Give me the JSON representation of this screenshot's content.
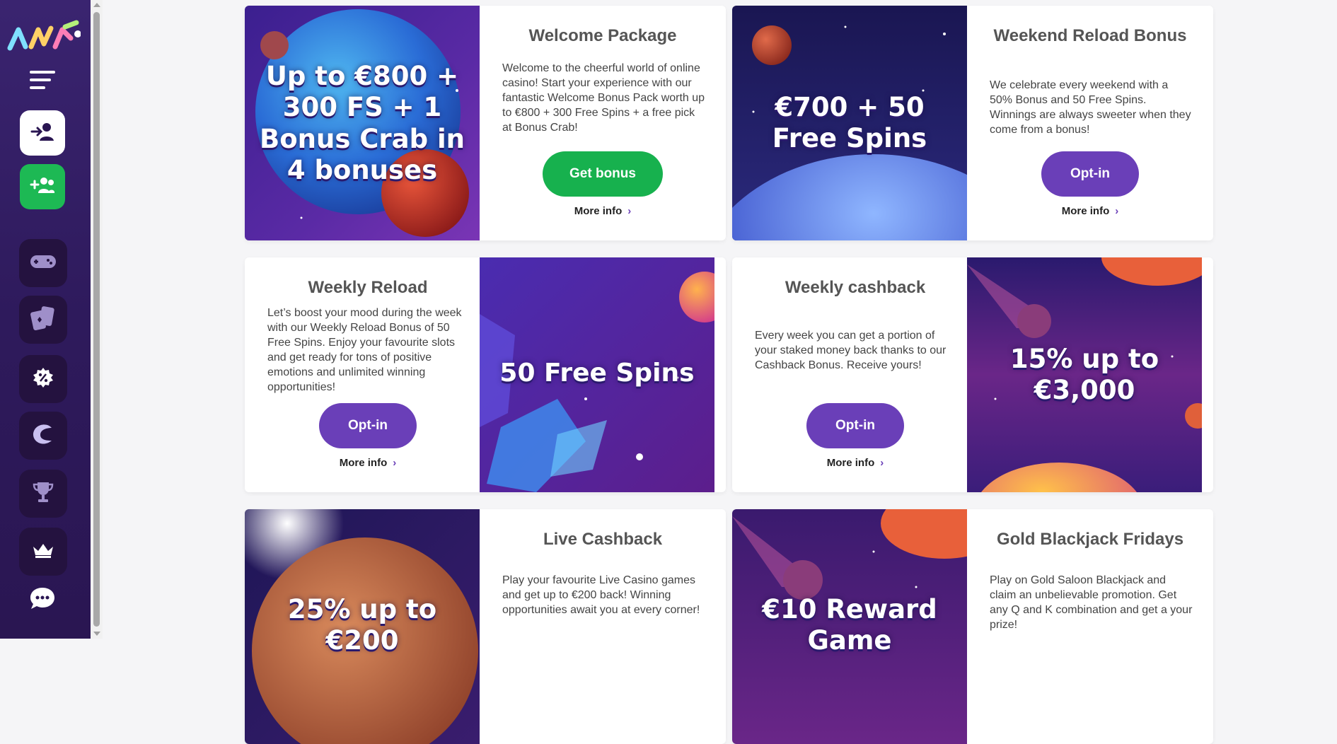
{
  "sidebar": {
    "logo_icon": "brand-logo",
    "items": [
      {
        "name": "login-icon"
      },
      {
        "name": "register-icon"
      },
      {
        "name": "games-icon"
      },
      {
        "name": "cards-icon"
      },
      {
        "name": "promotions-icon"
      },
      {
        "name": "crab-icon"
      },
      {
        "name": "trophy-icon"
      },
      {
        "name": "vip-crown-icon"
      },
      {
        "name": "chat-icon"
      }
    ]
  },
  "colors": {
    "sidebar_bg": "#3a2470",
    "green": "#17b14e",
    "purple": "#6a3fb8",
    "title_gray": "#555555"
  },
  "promos": [
    {
      "title": "Welcome Package",
      "image_text": "Up to €800 + 300 FS + 1 Bonus Crab in 4 bonuses",
      "description": "Welcome to the cheerful world of online casino! Start your experience with our fantastic Welcome Bonus Pack worth up to €800 + 300 Free Spins + a free pick at Bonus Crab!",
      "button": "Get bonus",
      "more": "More info"
    },
    {
      "title": "Weekend Reload Bonus",
      "image_text": "€700 + 50 Free Spins",
      "description": "We celebrate every weekend with a 50% Bonus and 50 Free Spins. Winnings are always sweeter when they come from a bonus!",
      "button": "Opt-in",
      "more": "More info"
    },
    {
      "title": "Weekly Reload",
      "image_text": "50 Free Spins",
      "description": "Let’s boost your mood during the week with our Weekly Reload Bonus of 50 Free Spins. Enjoy your favourite slots and get ready for tons of positive emotions and unlimited winning opportunities!",
      "button": "Opt-in",
      "more": "More info"
    },
    {
      "title": "Weekly cashback",
      "image_text": "15% up to €3,000",
      "description": "Every week you can get a portion of your staked money back thanks to our Cashback Bonus. Receive yours!",
      "button": "Opt-in",
      "more": "More info"
    },
    {
      "title": "Live Cashback",
      "image_text": "25% up to €200",
      "description": "Play your favourite Live Casino games and get up to €200 back! Winning opportunities await you at every corner!"
    },
    {
      "title": "Gold Blackjack Fridays",
      "image_text": "€10 Reward Game",
      "description": "Play on Gold Saloon Blackjack and claim an unbelievable promotion. Get any Q and K combination and get a your prize!"
    }
  ]
}
